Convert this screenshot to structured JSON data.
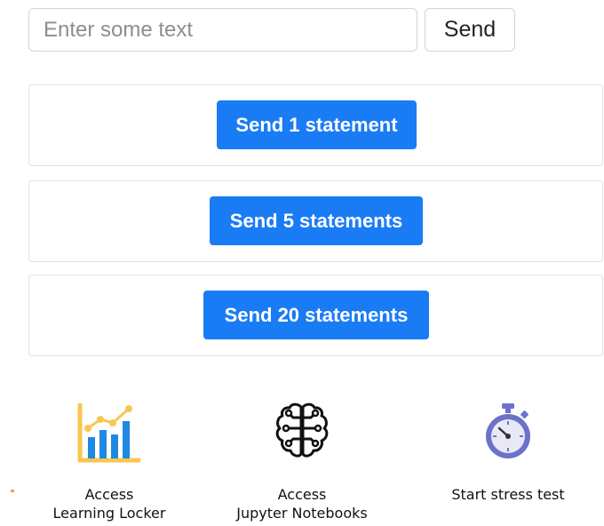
{
  "input": {
    "placeholder": "Enter some text",
    "value": ""
  },
  "send_button": {
    "label": "Send"
  },
  "statement_buttons": [
    {
      "label": "Send 1 statement"
    },
    {
      "label": "Send 5 statements"
    },
    {
      "label": "Send 20 statements"
    }
  ],
  "tools": [
    {
      "icon": "bar-chart-icon",
      "line1": "Access",
      "line2": "Learning Locker"
    },
    {
      "icon": "brain-circuit-icon",
      "line1": "Access",
      "line2": "Jupyter Notebooks"
    },
    {
      "icon": "stopwatch-icon",
      "line1": "Start stress test",
      "line2": ""
    }
  ],
  "colors": {
    "primary": "#1a7cf5",
    "border": "#ced4da",
    "chart_bars": "#1e88e5",
    "chart_axis": "#f9c74f",
    "stopwatch": "#6c72c9"
  }
}
